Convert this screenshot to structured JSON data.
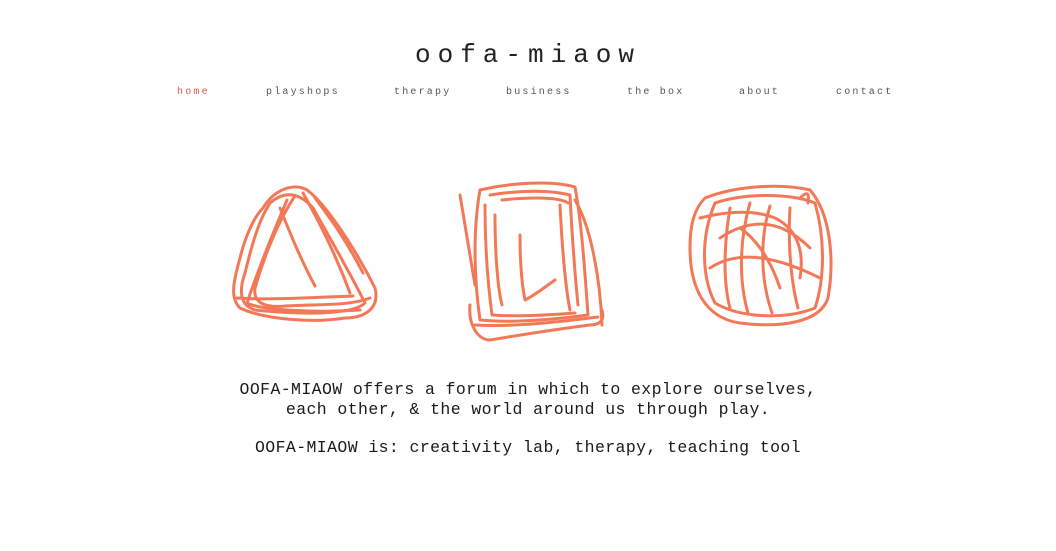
{
  "site": {
    "title": "oofa-miaow"
  },
  "nav": {
    "items": [
      {
        "label": "home"
      },
      {
        "label": "playshops"
      },
      {
        "label": "therapy"
      },
      {
        "label": "business"
      },
      {
        "label": "the box"
      },
      {
        "label": "about"
      },
      {
        "label": "contact"
      }
    ]
  },
  "hero": {
    "drawings": [
      "crayon-triangle",
      "crayon-square",
      "crayon-circle"
    ],
    "crayon_color": "#f26a45"
  },
  "intro": {
    "line1": "OOFA-MIAOW offers a forum in which to explore ourselves,",
    "line2": "each other, & the world around us through play.",
    "line3": "OOFA-MIAOW is: creativity lab, therapy, teaching tool"
  },
  "colors": {
    "accent": "#e8564a",
    "nav_text": "#555555",
    "body_text": "#1a1a1a"
  }
}
